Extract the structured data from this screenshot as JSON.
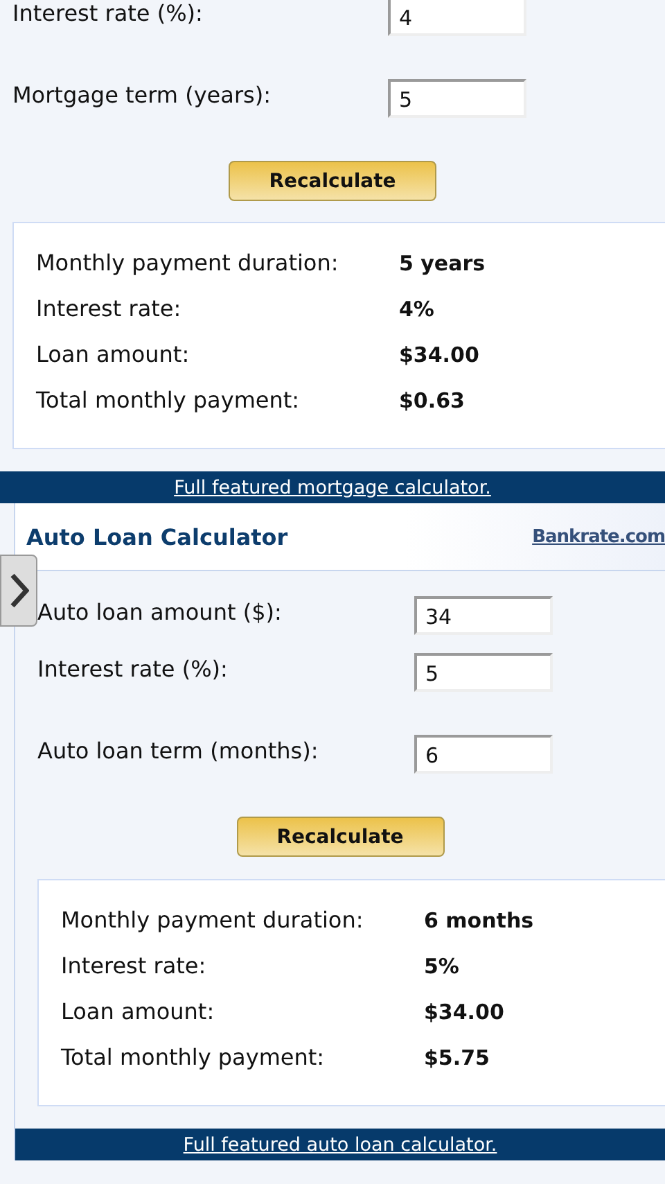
{
  "mortgage": {
    "fields": [
      {
        "label": "Interest rate (%):",
        "value": "4"
      },
      {
        "label": "Mortgage term (years):",
        "value": "5"
      }
    ],
    "button": "Recalculate",
    "results": [
      {
        "label": "Monthly payment duration:",
        "value": "5 years"
      },
      {
        "label": "Interest rate:",
        "value": "4%"
      },
      {
        "label": "Loan amount:",
        "value": "$34.00"
      },
      {
        "label": "Total monthly payment:",
        "value": "$0.63"
      }
    ],
    "link": "Full featured mortgage calculator."
  },
  "auto": {
    "title": "Auto Loan Calculator",
    "logo": "Bankrate.com",
    "fields": [
      {
        "label": "Auto loan amount ($):",
        "value": "34"
      },
      {
        "label": "Interest rate (%):",
        "value": "5"
      },
      {
        "label": "Auto loan term (months):",
        "value": "6"
      }
    ],
    "button": "Recalculate",
    "results": [
      {
        "label": "Monthly payment duration:",
        "value": "6 months"
      },
      {
        "label": "Interest rate:",
        "value": "5%"
      },
      {
        "label": "Loan amount:",
        "value": "$34.00"
      },
      {
        "label": "Total monthly payment:",
        "value": "$5.75"
      }
    ],
    "link": "Full featured auto loan calculator."
  }
}
